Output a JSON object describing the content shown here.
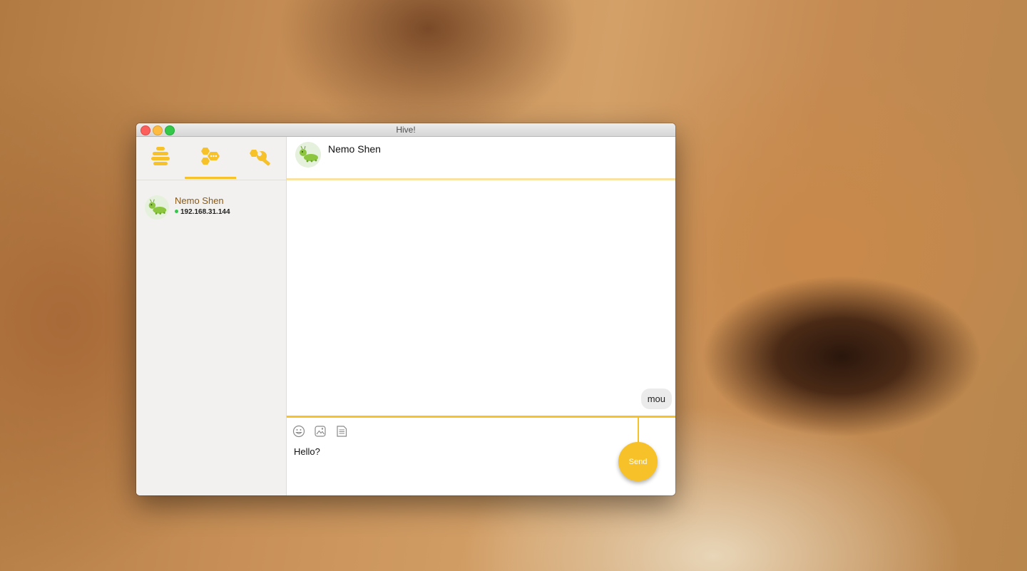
{
  "window": {
    "title": "Hive!"
  },
  "sidebar": {
    "tabs": [
      {
        "icon": "hive-icon"
      },
      {
        "icon": "chat-bubbles-icon",
        "active": true
      },
      {
        "icon": "wrench-settings-icon"
      }
    ],
    "contacts": [
      {
        "name": "Nemo Shen",
        "ip": "192.168.31.144",
        "status": "online",
        "avatar": "caterpillar-avatar"
      }
    ]
  },
  "chat": {
    "contact_name": "Nemo Shen",
    "messages": [
      {
        "text": "mou",
        "side": "right"
      }
    ]
  },
  "composer": {
    "tools": [
      "emoji-icon",
      "image-icon",
      "file-icon"
    ],
    "input_value": "Hello?",
    "send_label": "Send"
  },
  "colors": {
    "accent": "#f7c12a",
    "contact_name": "#8a5a14",
    "online": "#34c84a"
  }
}
